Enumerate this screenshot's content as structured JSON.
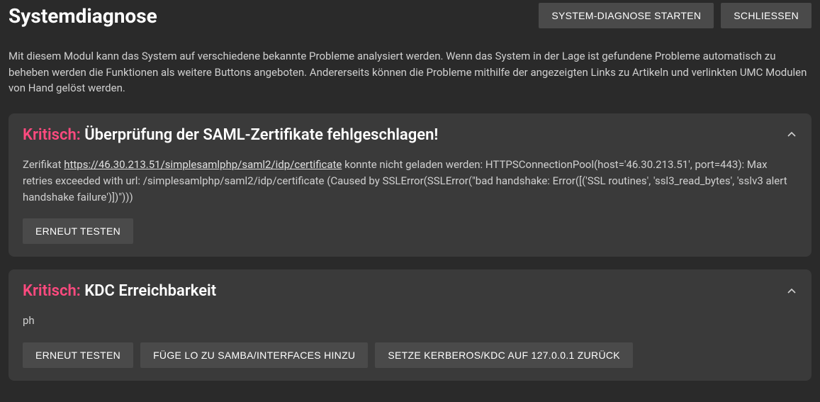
{
  "header": {
    "title": "Systemdiagnose",
    "buttons": {
      "start_diagnose": "SYSTEM-DIAGNOSE STARTEN",
      "close": "SCHLIESSEN"
    }
  },
  "description": "Mit diesem Modul kann das System auf verschiedene bekannte Probleme analysiert werden. Wenn das System in der Lage ist gefundene Probleme automatisch zu beheben werden die Funktionen als weitere Buttons angeboten. Andererseits können die Probleme mithilfe der angezeigten Links zu Artikeln und verlinkten UMC Modulen von Hand gelöst werden.",
  "cards": [
    {
      "severity_label": "Kritisch:",
      "title": "Überprüfung der SAML-Zertifikate fehlgeschlagen!",
      "body": {
        "prefix": "Zerifikat",
        "link_text": "https://46.30.213.51/simplesamlphp/saml2/idp/certificate",
        "suffix": "konnte nicht geladen werden: HTTPSConnectionPool(host='46.30.213.51', port=443): Max retries exceeded with url: /simplesamlphp/saml2/idp/certificate (Caused by SSLError(SSLError(\"bad handshake: Error([('SSL routines', 'ssl3_read_bytes', 'sslv3 alert handshake failure')])\")))"
      },
      "actions": {
        "retest": "ERNEUT TESTEN"
      }
    },
    {
      "severity_label": "Kritisch:",
      "title": "KDC Erreichbarkeit",
      "body_text": "ph",
      "actions": {
        "retest": "ERNEUT TESTEN",
        "add_lo": "FÜGE LO ZU SAMBA/INTERFACES HINZU",
        "set_kerberos": "SETZE KERBEROS/KDC AUF 127.0.0.1 ZURÜCK"
      }
    }
  ]
}
